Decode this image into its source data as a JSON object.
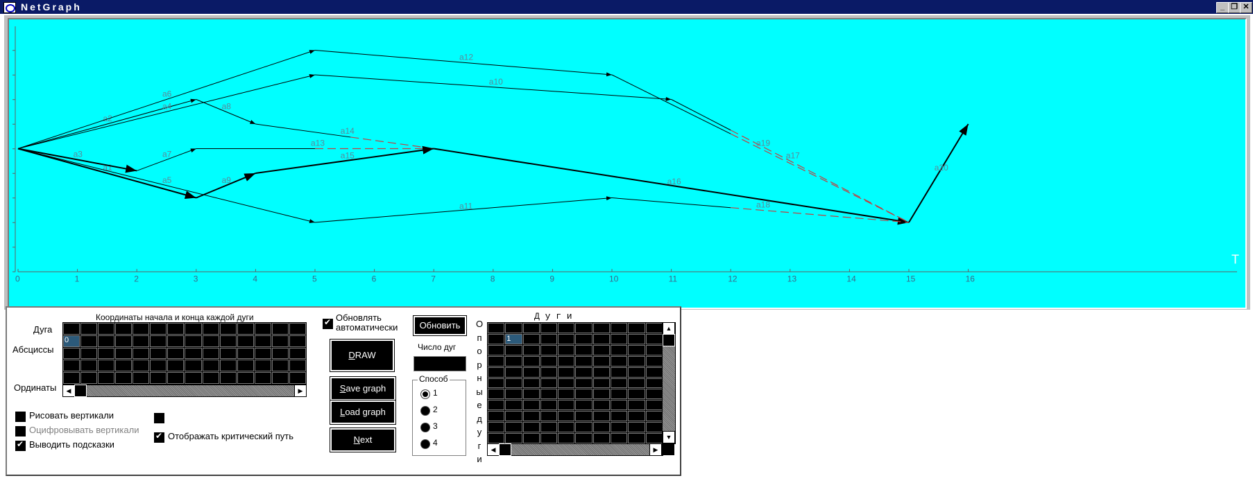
{
  "window": {
    "title": "NetGraph"
  },
  "graph": {
    "x_axis_ticks": [
      "0",
      "1",
      "2",
      "3",
      "4",
      "5",
      "6",
      "7",
      "8",
      "9",
      "10",
      "11",
      "12",
      "13",
      "14",
      "15",
      "16"
    ],
    "axis_end_label": "T",
    "nodes": [
      [
        0,
        4.5
      ],
      [
        3,
        2.5
      ],
      [
        3,
        6.5
      ],
      [
        4,
        5.5
      ],
      [
        2,
        4
      ],
      [
        5,
        8.5
      ],
      [
        5,
        7.5
      ],
      [
        4,
        6
      ],
      [
        5,
        1.5
      ],
      [
        7,
        5
      ],
      [
        10,
        2.5
      ],
      [
        10,
        7.5
      ],
      [
        11,
        6.5
      ],
      [
        15,
        1.5
      ],
      [
        16,
        5.5
      ]
    ],
    "arcs": [
      {
        "id": "a1",
        "from": [
          0,
          4.5
        ],
        "to": [
          3,
          2.5
        ],
        "critical": true
      },
      {
        "id": "a2",
        "from": [
          0,
          4.5
        ],
        "to": [
          3,
          6.5
        ]
      },
      {
        "id": "a3",
        "from": [
          0,
          4.5
        ],
        "to": [
          2,
          3.6
        ],
        "critical": true
      },
      {
        "id": "a4",
        "from": [
          0,
          4.5
        ],
        "to": [
          5,
          7.5
        ]
      },
      {
        "id": "a5",
        "from": [
          0,
          4.5
        ],
        "to": [
          5,
          1.5
        ]
      },
      {
        "id": "a6",
        "from": [
          0,
          4.5
        ],
        "to": [
          5,
          8.5
        ]
      },
      {
        "id": "a7",
        "from": [
          2,
          3.6
        ],
        "to": [
          3,
          4.5
        ]
      },
      {
        "id": "a8",
        "from": [
          3,
          6.5
        ],
        "to": [
          4,
          5.5
        ]
      },
      {
        "id": "a9",
        "from": [
          3,
          2.5
        ],
        "to": [
          4,
          3.5
        ],
        "critical": true
      },
      {
        "id": "a10",
        "from": [
          5,
          7.5
        ],
        "to": [
          11,
          6.5
        ]
      },
      {
        "id": "a11",
        "from": [
          5,
          1.5
        ],
        "to": [
          10,
          2.5
        ]
      },
      {
        "id": "a12",
        "from": [
          5,
          8.5
        ],
        "to": [
          10,
          7.5
        ]
      },
      {
        "id": "a13",
        "from": [
          3,
          4.5
        ],
        "to": [
          7,
          4.5
        ],
        "dashed_from": 5
      },
      {
        "id": "a14",
        "from": [
          4,
          5.5
        ],
        "to": [
          7,
          4.5
        ],
        "dashed_from": 5.6
      },
      {
        "id": "a15",
        "from": [
          4,
          3.5
        ],
        "to": [
          7,
          4.5
        ],
        "critical": true
      },
      {
        "id": "a16",
        "from": [
          7,
          4.5
        ],
        "to": [
          15,
          1.5
        ],
        "critical": true
      },
      {
        "id": "a17",
        "from": [
          11,
          6.5
        ],
        "to": [
          15,
          1.5
        ],
        "dashed_from": 12
      },
      {
        "id": "a18",
        "from": [
          10,
          2.5
        ],
        "to": [
          15,
          1.5
        ],
        "dashed_from": 12
      },
      {
        "id": "a19",
        "from": [
          10,
          7.5
        ],
        "to": [
          15,
          1.5
        ],
        "dashed_from": 12
      },
      {
        "id": "a20",
        "from": [
          15,
          1.5
        ],
        "to": [
          16,
          5.5
        ],
        "critical": true
      }
    ]
  },
  "coords_grid": {
    "title": "Координаты начала и конца каждой дуги",
    "row_labels": {
      "arc": "Дуга",
      "abscissa": "Абсциссы",
      "ordinate": "Ординаты"
    },
    "first_cell": "0"
  },
  "options": {
    "draw_verticals": "Рисовать вертикали",
    "digitize_verticals": "Оцифровывать вертикали",
    "show_hints": "Выводить подсказки",
    "show_critical_path": "Отображать критический путь",
    "auto_update": "Обновлять автоматически"
  },
  "buttons": {
    "update": "Обновить",
    "draw": "DRAW",
    "save": "Save graph",
    "load": "Load graph",
    "next": "Next"
  },
  "arc_count_label": "Число дуг",
  "method": {
    "label": "Способ",
    "options": [
      "1",
      "2",
      "3",
      "4"
    ],
    "selected": "1"
  },
  "reference_arcs_label": "Опорные дуги",
  "arcs_grid": {
    "title": "Д у г и",
    "first_cell": "1"
  }
}
